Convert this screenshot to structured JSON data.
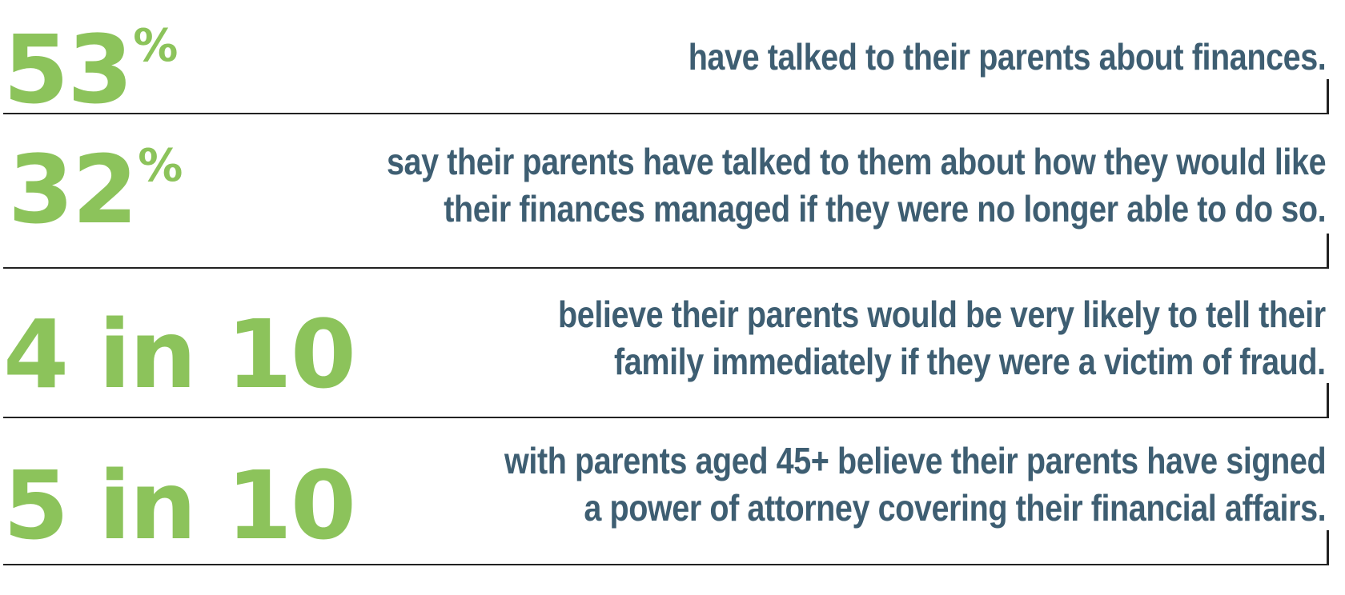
{
  "colors": {
    "accent_green": "#8cc35b",
    "text_slate": "#3e5e72",
    "rule": "#222222",
    "background": "#ffffff"
  },
  "stats": [
    {
      "value": "53",
      "suffix": "%",
      "lines": [
        "have talked to their parents about finances."
      ]
    },
    {
      "value": "32",
      "suffix": "%",
      "lines": [
        "say their parents have talked to them about how they would like",
        "their finances managed if they were no longer able to do so."
      ]
    },
    {
      "value": "4 in 10",
      "suffix": "",
      "lines": [
        "believe their parents would be very likely to tell their",
        "family immediately if they were a victim of fraud."
      ]
    },
    {
      "value": "5 in 10",
      "suffix": "",
      "lines": [
        "with parents aged 45+ believe their parents have signed",
        "a power of attorney covering their financial affairs."
      ]
    }
  ]
}
